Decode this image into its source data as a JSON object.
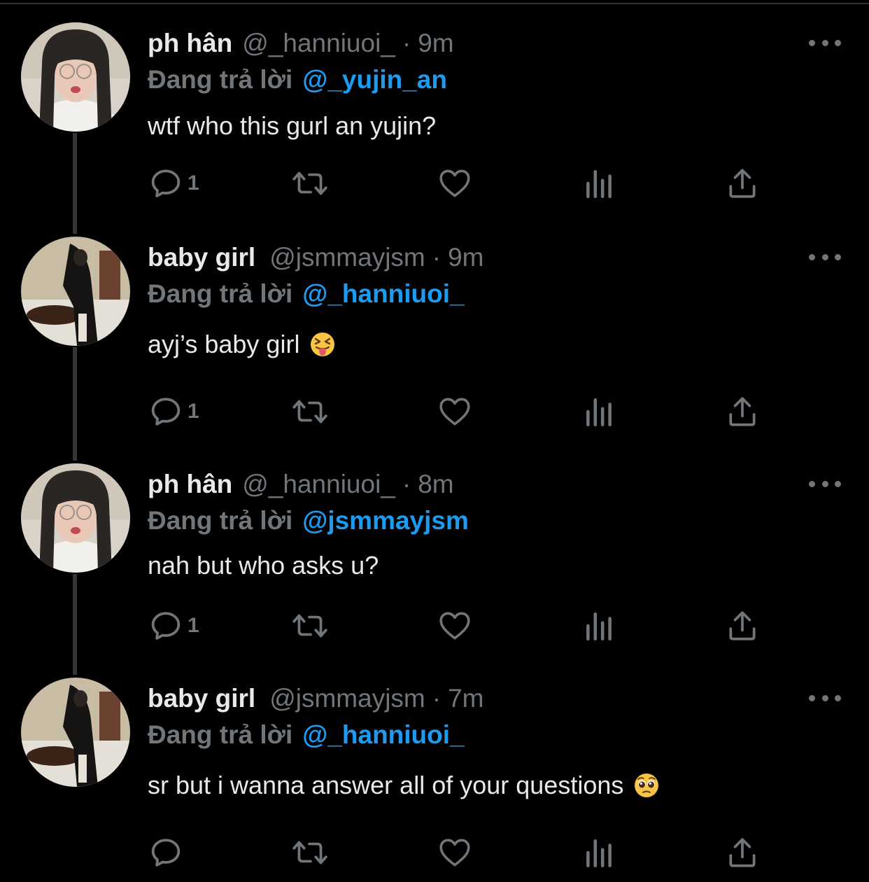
{
  "tweets": [
    {
      "name": "ph hân",
      "handle": "@_hanniuoi_",
      "time": "9m",
      "separator": "·",
      "reply_label": "Đang trả lời",
      "reply_to": "@_yujin_an",
      "text": "wtf who this gurl an yujin?",
      "emoji": "",
      "reply_count": "1",
      "avatar": "girl-glasses-avatar"
    },
    {
      "name": "baby girl",
      "handle": "@jsmmayjsm",
      "time": "9m",
      "separator": "·",
      "reply_label": "Đang trả lời",
      "reply_to": "@_hanniuoi_",
      "text": "ayj’s baby girl",
      "emoji": "squinting-face-with-tongue-emoji",
      "reply_count": "1",
      "avatar": "girl-chair-avatar"
    },
    {
      "name": "ph hân",
      "handle": "@_hanniuoi_",
      "time": "8m",
      "separator": "·",
      "reply_label": "Đang trả lời",
      "reply_to": "@jsmmayjsm",
      "text": "nah but who asks u?",
      "emoji": "",
      "reply_count": "1",
      "avatar": "girl-glasses-avatar"
    },
    {
      "name": "baby girl",
      "handle": "@jsmmayjsm",
      "time": "7m",
      "separator": "·",
      "reply_label": "Đang trả lời",
      "reply_to": "@_hanniuoi_",
      "text": "sr but i wanna answer all of your questions",
      "emoji": "pleading-face-emoji",
      "reply_count": "",
      "avatar": "girl-chair-avatar"
    }
  ],
  "icons": {
    "reply": "speech-bubble-icon",
    "retweet": "retweet-icon",
    "like": "heart-icon",
    "views": "bar-chart-icon",
    "share": "share-upload-icon",
    "more": "more-dots-icon"
  },
  "colors": {
    "background": "#000000",
    "text": "#e7e9ea",
    "muted": "#71767b",
    "link": "#1d9bf0",
    "thread_line": "#333639"
  }
}
